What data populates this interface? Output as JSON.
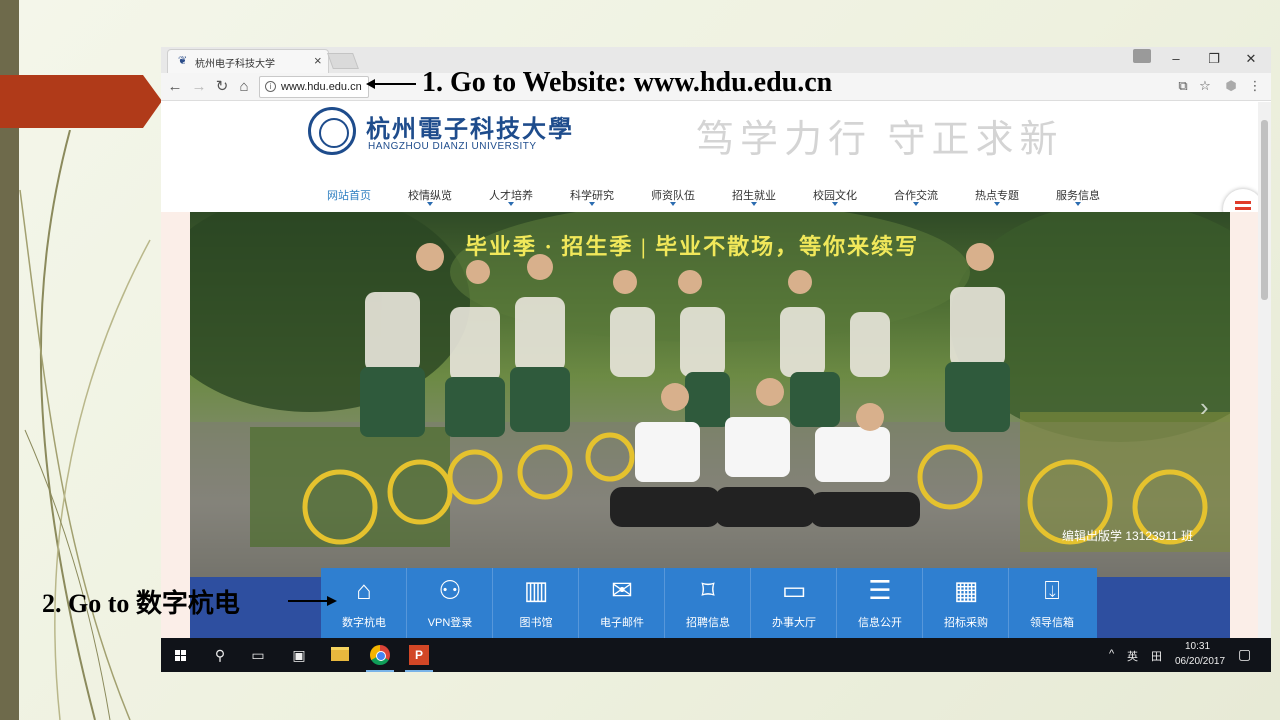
{
  "browser": {
    "tab_title": "杭州电子科技大学",
    "url": "www.hdu.edu.cn",
    "nav_icons": [
      "back-icon",
      "forward-icon",
      "reload-icon",
      "home-icon"
    ]
  },
  "site": {
    "logo_cn": "杭州電子科技大學",
    "logo_en": "HANGZHOU DIANZI UNIVERSITY",
    "motto": "笃学力行 守正求新",
    "nav": [
      {
        "label": "网站首页"
      },
      {
        "label": "校情纵览"
      },
      {
        "label": "人才培养"
      },
      {
        "label": "科学研究"
      },
      {
        "label": "师资队伍"
      },
      {
        "label": "招生就业"
      },
      {
        "label": "校园文化"
      },
      {
        "label": "合作交流"
      },
      {
        "label": "热点专题"
      },
      {
        "label": "服务信息"
      }
    ],
    "banner": {
      "caption": "毕业季 · 招生季 | 毕业不散场，等你来续写",
      "credit": "编辑出版学 13123911 班"
    },
    "quick_links": [
      {
        "label": "数字杭电",
        "icon": "home-icon",
        "glyph": "⌂"
      },
      {
        "label": "VPN登录",
        "icon": "users-icon",
        "glyph": "⚇"
      },
      {
        "label": "图书馆",
        "icon": "library-icon",
        "glyph": "▥"
      },
      {
        "label": "电子邮件",
        "icon": "mail-icon",
        "glyph": "✉"
      },
      {
        "label": "招聘信息",
        "icon": "bookmark-icon",
        "glyph": "⌑"
      },
      {
        "label": "办事大厅",
        "icon": "monitor-icon",
        "glyph": "▭"
      },
      {
        "label": "信息公开",
        "icon": "clipboard-icon",
        "glyph": "☰"
      },
      {
        "label": "招标采购",
        "icon": "building-icon",
        "glyph": "▦"
      },
      {
        "label": "领导信箱",
        "icon": "inbox-icon",
        "glyph": "⍗"
      }
    ]
  },
  "taskbar": {
    "ime_lang": "英",
    "ime_mode": "田",
    "time": "10:31",
    "date": "06/20/2017",
    "ppt_label": "P"
  },
  "annotations": {
    "step1": "1. Go to Website: www.hdu.edu.cn",
    "step2": "2. Go to 数字杭电"
  }
}
